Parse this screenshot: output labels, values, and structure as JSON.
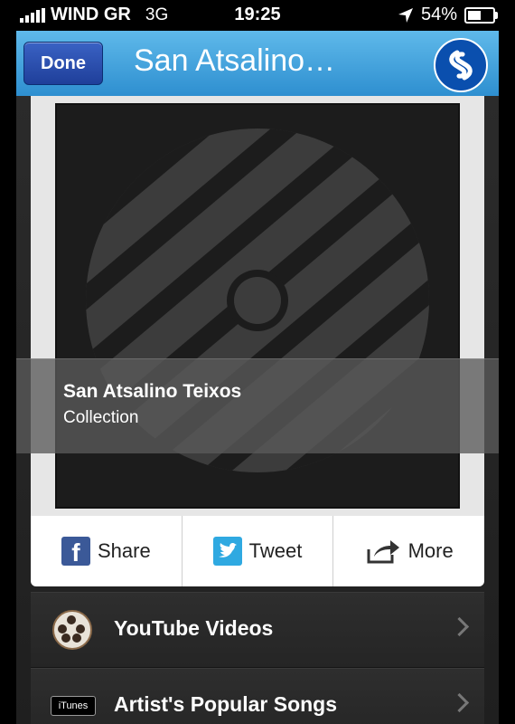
{
  "status_bar": {
    "carrier": "WIND GR",
    "network": "3G",
    "time": "19:25",
    "battery": "54%",
    "battery_level": 0.54
  },
  "nav": {
    "done_label": "Done",
    "title": "San Atsalino…"
  },
  "track": {
    "title": "San Atsalino Teixos",
    "subtitle": "Collection"
  },
  "share": {
    "share_label": "Share",
    "tweet_label": "Tweet",
    "more_label": "More"
  },
  "list": [
    {
      "label": "YouTube Videos",
      "icon": "film-reel-icon"
    },
    {
      "label": "Artist's Popular Songs",
      "icon": "itunes-icon",
      "badge": "iTunes"
    }
  ],
  "colors": {
    "nav_gradient_top": "#5fb9ea",
    "nav_gradient_bottom": "#2e8fd0",
    "done_button": "#1f3f9a",
    "facebook": "#3b5998",
    "twitter": "#2fa9e1"
  }
}
